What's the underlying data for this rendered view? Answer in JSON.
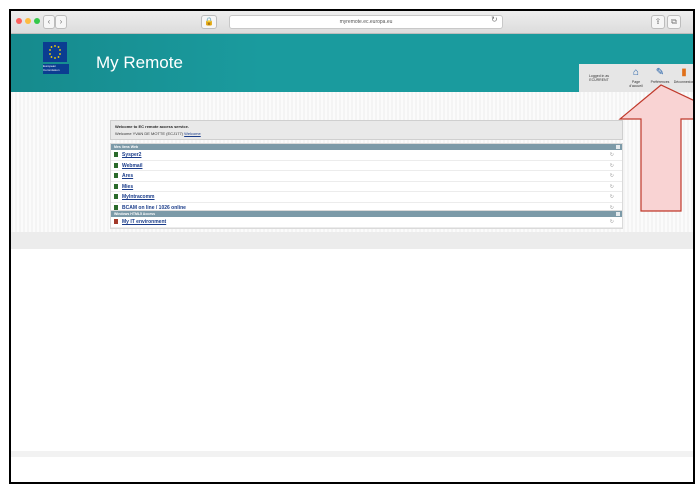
{
  "browser": {
    "url": "myremote.ec.europa.eu",
    "back": "‹",
    "forward": "›",
    "lock": "🔒",
    "reload": "↻",
    "share": "⇪",
    "tabs": "⧉"
  },
  "header": {
    "title": "My Remote",
    "logo_text": "European Commission",
    "user_box": "Logged in as ECURRENT",
    "buttons": [
      {
        "label": "Page d'accueil",
        "icon": "home-icon",
        "glyph": "⌂"
      },
      {
        "label": "Préférences",
        "icon": "preferences-icon",
        "glyph": "✎"
      },
      {
        "label": "Déconnexion",
        "icon": "logout-icon",
        "glyph": "▮"
      }
    ]
  },
  "welcome": {
    "line1": "Welcome to EC remote access service.",
    "line2": "Welcome YVAN DE MOTTE (ECJ177)",
    "link": "Welcome"
  },
  "panels": [
    {
      "title": "Mes liens Web",
      "items": [
        {
          "label": "Sysper2",
          "icon": "green"
        },
        {
          "label": "Webmail",
          "icon": "green"
        },
        {
          "label": "Ares",
          "icon": "green"
        },
        {
          "label": "Mies",
          "icon": "green"
        },
        {
          "label": "MyIntracomm",
          "icon": "green"
        },
        {
          "label": "BCAM on line / 1026 online",
          "icon": "green"
        }
      ]
    },
    {
      "title": "Windows HTML5 Access",
      "items": [
        {
          "label": "My IT environment",
          "icon": "red"
        }
      ]
    }
  ],
  "colors": {
    "header": "#1a9b9e",
    "link": "#1a3c8a",
    "panel_header": "#7c9aa8",
    "arrow_fill": "#f9d3d3",
    "arrow_stroke": "#c0392b"
  }
}
